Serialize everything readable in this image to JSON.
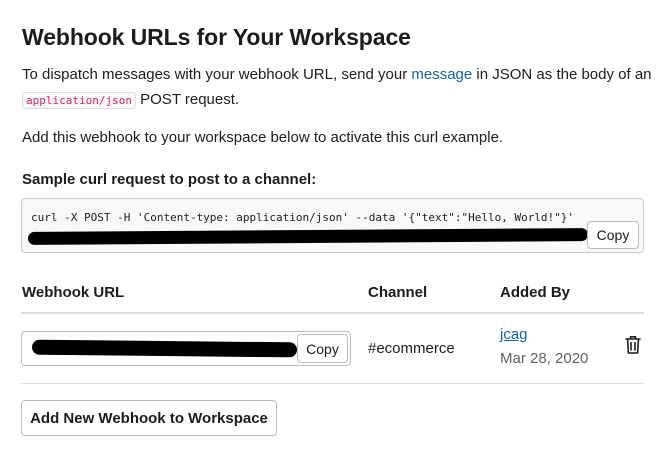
{
  "page": {
    "title": "Webhook URLs for Your Workspace"
  },
  "intro": {
    "before_link": "To dispatch messages with your webhook URL, send your ",
    "link": "message",
    "after_link": " in JSON as the body of an ",
    "code": "application/json",
    "end": " POST request."
  },
  "activate_text": "Add this webhook to your workspace below to activate this curl example.",
  "sample": {
    "label": "Sample curl request to post to a channel:",
    "curl_line1": "curl -X POST -H 'Content-type: application/json' --data '{\"text\":\"Hello, World!\"}'",
    "copy_label": "Copy"
  },
  "table": {
    "headers": {
      "url": "Webhook URL",
      "channel": "Channel",
      "added_by": "Added By"
    },
    "rows": [
      {
        "copy_label": "Copy",
        "channel": "#ecommerce",
        "added_by": "jcag",
        "added_date": "Mar 28, 2020"
      }
    ]
  },
  "actions": {
    "add_new": "Add New Webhook to Workspace"
  },
  "icons": {
    "delete": "trash-icon"
  },
  "colors": {
    "link": "#1264a3",
    "code_text": "#e01e5a",
    "muted": "#616061"
  }
}
